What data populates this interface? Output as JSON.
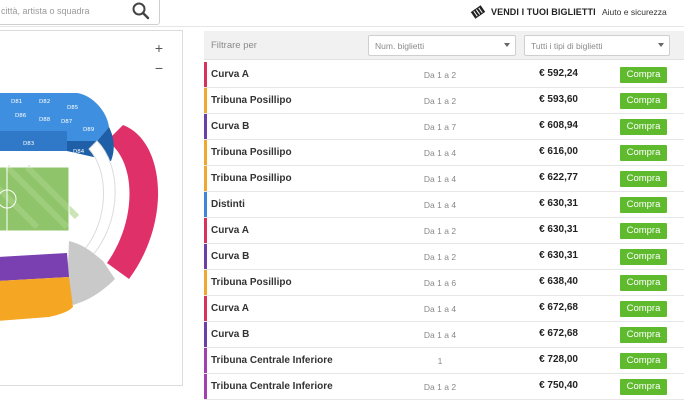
{
  "header": {
    "search_placeholder": "città, artista o squadra",
    "sell_label": "VENDI I TUOI BIGLIETTI",
    "help_label": "Aiuto e sicurezza"
  },
  "map": {
    "zoom_in": "+",
    "zoom_out": "−",
    "sections": [
      "D82",
      "D83",
      "D84",
      "D86",
      "D88",
      "D89",
      "D85",
      "D87",
      "D81"
    ]
  },
  "filters": {
    "label": "Filtrare per",
    "quantity_select": "Num. biglietti",
    "type_select": "Tutti i tipi di biglietti"
  },
  "colors": {
    "curva_a": "#d8315b",
    "tribuna_posillipo": "#f0a830",
    "curva_b": "#6a3fa8",
    "distinti": "#3f86d6",
    "tribuna_centrale": "#a340b0",
    "buy_button": "#5fba2e"
  },
  "listings": [
    {
      "sector": "Curva A",
      "qty": "Da 1 a 2",
      "price": "€ 592,24",
      "button": "Compra",
      "color": "#d8315b"
    },
    {
      "sector": "Tribuna Posillipo",
      "qty": "Da 1 a 2",
      "price": "€ 593,60",
      "button": "Compra",
      "color": "#f0a830"
    },
    {
      "sector": "Curva B",
      "qty": "Da 1 a 7",
      "price": "€ 608,94",
      "button": "Compra",
      "color": "#6a3fa8"
    },
    {
      "sector": "Tribuna Posillipo",
      "qty": "Da 1 a 4",
      "price": "€ 616,00",
      "button": "Compra",
      "color": "#f0a830"
    },
    {
      "sector": "Tribuna Posillipo",
      "qty": "Da 1 a 4",
      "price": "€ 622,77",
      "button": "Compra",
      "color": "#f0a830"
    },
    {
      "sector": "Distinti",
      "qty": "Da 1 a 4",
      "price": "€ 630,31",
      "button": "Compra",
      "color": "#3f86d6"
    },
    {
      "sector": "Curva A",
      "qty": "Da 1 a 2",
      "price": "€ 630,31",
      "button": "Compra",
      "color": "#d8315b"
    },
    {
      "sector": "Curva B",
      "qty": "Da 1 a 2",
      "price": "€ 630,31",
      "button": "Compra",
      "color": "#6a3fa8"
    },
    {
      "sector": "Tribuna Posillipo",
      "qty": "Da 1 a 6",
      "price": "€ 638,40",
      "button": "Compra",
      "color": "#f0a830"
    },
    {
      "sector": "Curva A",
      "qty": "Da 1 a 4",
      "price": "€ 672,68",
      "button": "Compra",
      "color": "#d8315b"
    },
    {
      "sector": "Curva B",
      "qty": "Da 1 a 4",
      "price": "€ 672,68",
      "button": "Compra",
      "color": "#6a3fa8"
    },
    {
      "sector": "Tribuna Centrale Inferiore",
      "qty": "1",
      "price": "€ 728,00",
      "button": "Compra",
      "color": "#a340b0"
    },
    {
      "sector": "Tribuna Centrale Inferiore",
      "qty": "Da 1 a 2",
      "price": "€ 750,40",
      "button": "Compra",
      "color": "#a340b0"
    }
  ]
}
